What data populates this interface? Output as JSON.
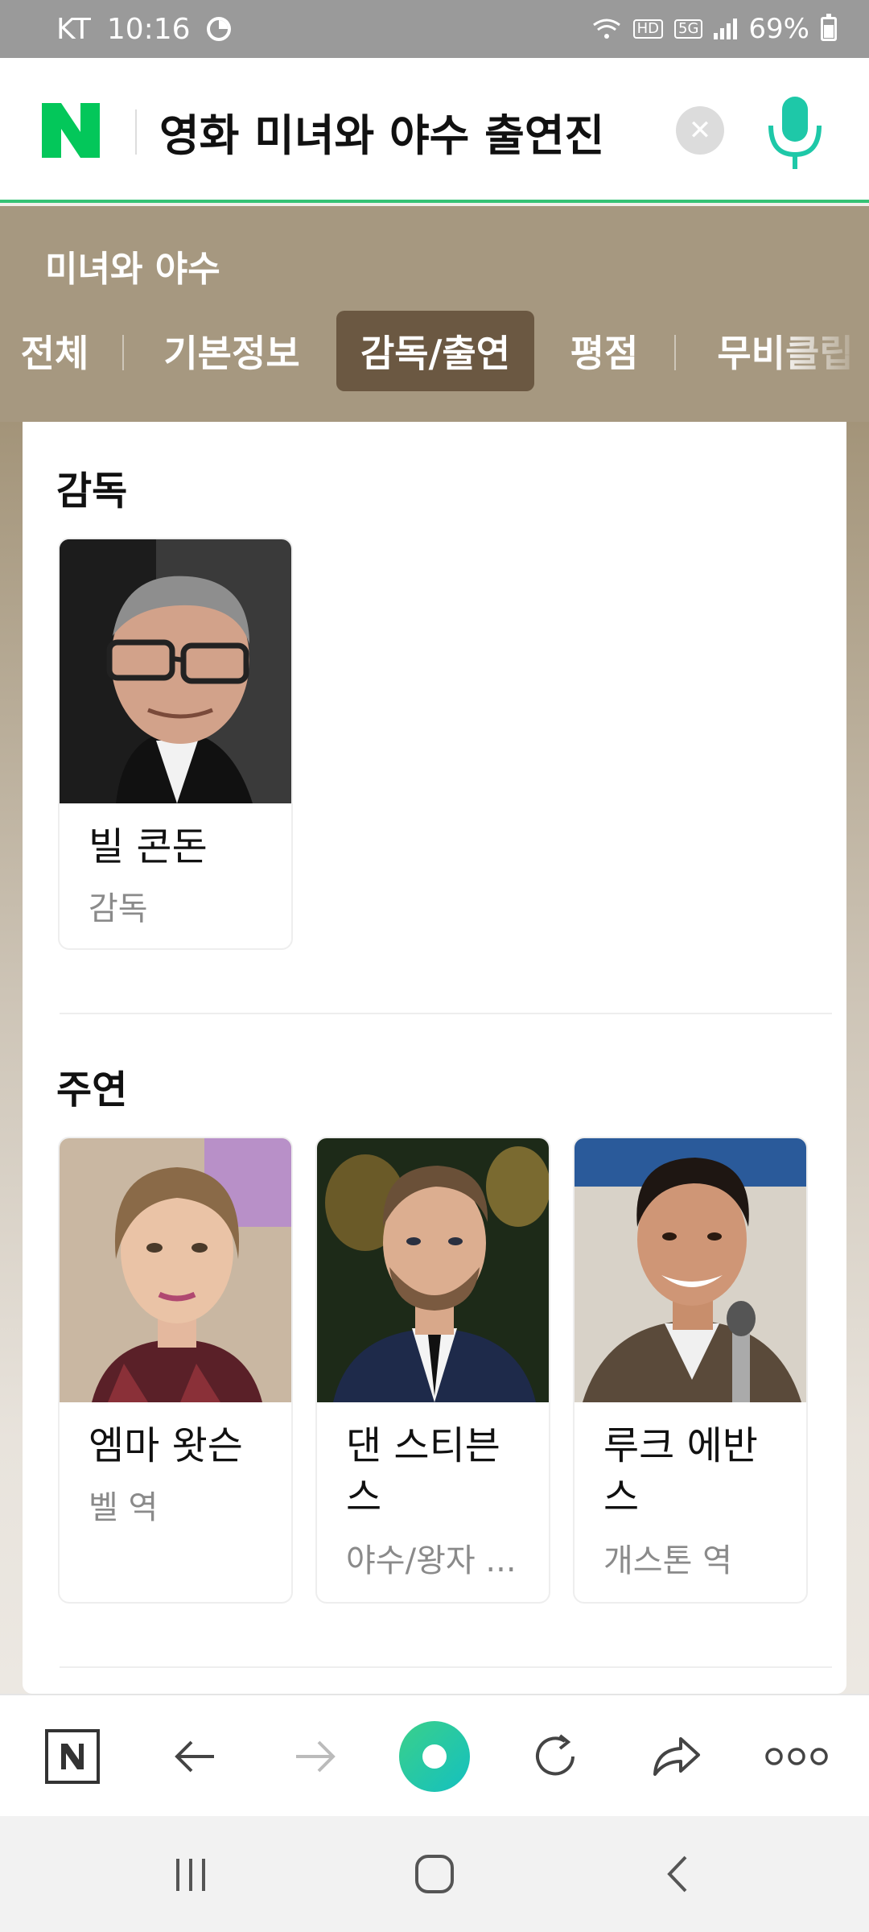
{
  "status_bar": {
    "carrier": "KT",
    "time": "10:16",
    "battery": "69%",
    "network": "5G"
  },
  "search": {
    "query": "영화 미녀와 야수 출연진"
  },
  "movie": {
    "title": "미녀와 야수",
    "tabs": [
      {
        "label": "전체"
      },
      {
        "label": "기본정보"
      },
      {
        "label": "감독/출연",
        "active": true
      },
      {
        "label": "평점"
      },
      {
        "label": "무비클립"
      }
    ]
  },
  "director_section": {
    "title": "감독",
    "people": [
      {
        "name": "빌 콘돈",
        "role": "감독"
      }
    ]
  },
  "cast_section": {
    "title": "주연",
    "people": [
      {
        "name": "엠마 왓슨",
        "role": "벨 역"
      },
      {
        "name_line1": "댄 스티븐",
        "name_line2": "스",
        "role": "야수/왕자 ..."
      },
      {
        "name_line1": "루크 에반",
        "name_line2": "스",
        "role": "개스톤 역"
      }
    ]
  },
  "colors": {
    "brand_green": "#03c75a",
    "header_brown": "#a69880",
    "active_tab": "#6b5842"
  }
}
